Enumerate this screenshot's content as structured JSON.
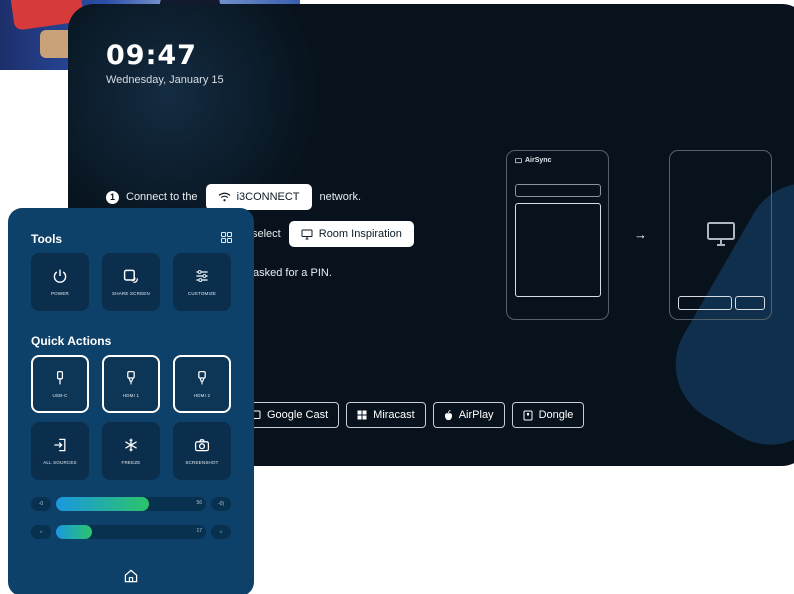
{
  "lockscreen": {
    "time": "09:47",
    "date": "Wednesday, January 15"
  },
  "steps": [
    {
      "number": "1",
      "prefix": "Connect to the",
      "pill": "i3CONNECT",
      "suffix": "network."
    },
    {
      "prefix": "select",
      "pill": "Room Inspiration"
    },
    {
      "text": "asked for a PIN."
    }
  ],
  "diagram": {
    "phone_app": "AirSync",
    "arrow": "→"
  },
  "methods": [
    {
      "label": "Google Cast",
      "icon": "cast-icon"
    },
    {
      "label": "Miracast",
      "icon": "windows-icon"
    },
    {
      "label": "AirPlay",
      "icon": "apple-icon"
    },
    {
      "label": "Dongle",
      "icon": "dongle-icon"
    }
  ],
  "panel": {
    "tools_title": "Tools",
    "tools": [
      {
        "label": "POWER",
        "icon": "power-icon"
      },
      {
        "label": "SHARE SCREEN",
        "icon": "share-screen-icon"
      },
      {
        "label": "CUSTOMIZE",
        "icon": "sliders-icon"
      }
    ],
    "quick_title": "Quick Actions",
    "quick_actions": [
      {
        "label": "USB-C",
        "icon": "usb-icon",
        "selected": true
      },
      {
        "label": "HDMI 1",
        "icon": "hdmi-icon",
        "selected": true
      },
      {
        "label": "HDMI 2",
        "icon": "hdmi-icon",
        "selected": true
      },
      {
        "label": "ALL SOURCES",
        "icon": "input-icon",
        "selected": false
      },
      {
        "label": "FREEZE",
        "icon": "snowflake-icon",
        "selected": false
      },
      {
        "label": "SCREENSHOT",
        "icon": "camera-icon",
        "selected": false
      }
    ],
    "volume": {
      "value": "56",
      "level": 0.62,
      "minus": "-0",
      "plus": "-0)"
    },
    "brightness": {
      "value": "17",
      "level": 0.24,
      "minus": "☼",
      "plus": "☼"
    }
  },
  "colors": {
    "display_bg": "#07121c",
    "panel_bg": "#0e4169",
    "tile_bg": "#0a2e4c",
    "slider_start": "#1a97e0",
    "slider_end": "#2cc46a"
  }
}
